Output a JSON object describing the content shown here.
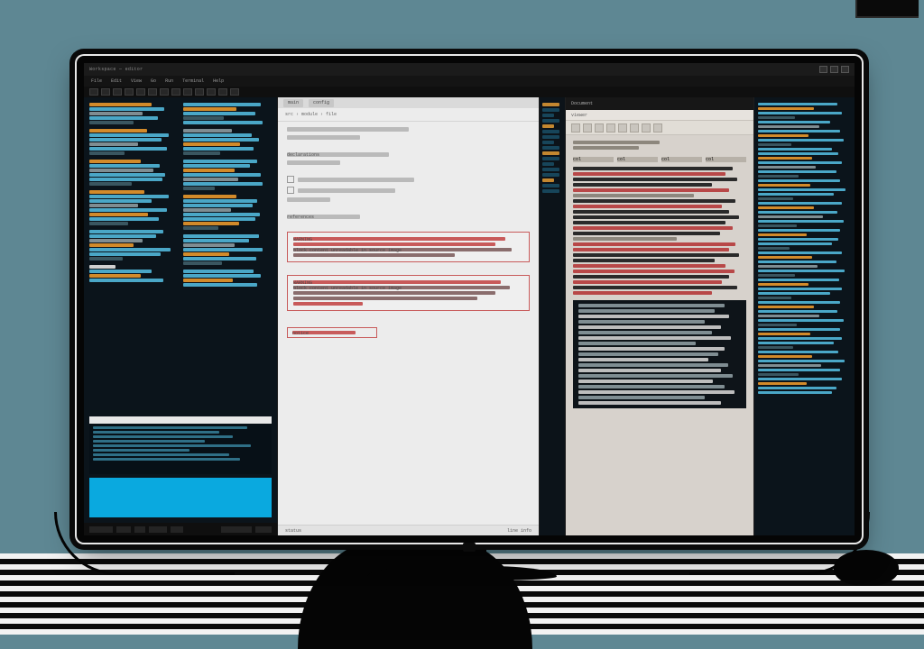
{
  "window": {
    "title": "Workspace — editor",
    "menus": [
      "File",
      "Edit",
      "View",
      "Go",
      "Run",
      "Terminal",
      "Help"
    ]
  },
  "center_panel": {
    "tabs": [
      "main",
      "config"
    ],
    "breadcrumb": "src › module › file",
    "header_a": "declarations",
    "header_b": "references",
    "warning_a_title": "WARNING",
    "warning_a_body": "block content unreadable in source image",
    "warning_b_title": "WARNING",
    "warning_b_body": "block content unreadable in source image",
    "small_box_label": "notice",
    "status_left": "status",
    "status_right": "line info"
  },
  "doc_panel": {
    "titlebar": "Document",
    "subtitle": "viewer",
    "table_headers": [
      "col",
      "col",
      "col",
      "col"
    ]
  },
  "colors": {
    "accent_teal": "#4aa7c7",
    "accent_orange": "#d28a2a",
    "error_red": "#c85a5a",
    "selection_blue": "#0aa9df"
  }
}
